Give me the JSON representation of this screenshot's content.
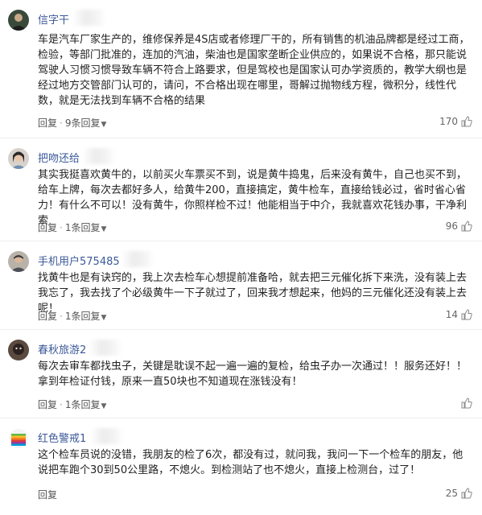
{
  "comments": [
    {
      "username": "信字干",
      "avatar": "dark-portrait",
      "text": "车是汽车厂家生产的，维修保养是4S店或者修理厂干的，所有销售的机油品牌都是经过工商，检验，等部门批准的，连加的汽油，柴油也是国家垄断企业供应的，如果说不合格，那只能说驾驶人习惯习惯导致车辆不符合上路要求，但是驾校也是国家认可办学资质的，教学大纲也是经过地方交管部门认可的，请问，不合格出现在哪里，哥解过抛物线方程，微积分，线性代数，就是无法找到车辆不合格的结果",
      "reply_label": "回复",
      "replies_label": "9条回复",
      "likes": "170"
    },
    {
      "username": "把吻还给",
      "avatar": "girl-portrait",
      "text": "其实我挺喜欢黄牛的，以前买火车票买不到，说是黄牛捣鬼，后来没有黄牛，自己也买不到，给车上牌，每次去都好多人，给黄牛200，直接搞定，黄牛检车，直接给钱必过，省时省心省力！有什么不可以！没有黄牛，你照样检不过！他能相当于中介，我就喜欢花钱办事，干净利索",
      "reply_label": "回复",
      "replies_label": "1条回复",
      "likes": "96"
    },
    {
      "username": "手机用户575485",
      "avatar": "person-portrait",
      "text": "找黄牛也是有诀窍的，我上次去检车心想提前准备哈，就去把三元催化拆下来洗，没有装上去我忘了，我去找了个必级黄牛一下子就过了，回来我才想起来，他妈的三元催化还没有装上去呢！",
      "reply_label": "回复",
      "replies_label": "1条回复",
      "likes": "14"
    },
    {
      "username": "春秋旅游2",
      "avatar": "dark-face",
      "text": "每次去审车都找虫子，关键是耽误不起一遍一遍的复检，给虫子办一次通过！！服务还好！！拿到年检证付钱，原来一直50块也不知道现在涨钱没有！",
      "reply_label": "回复",
      "replies_label": "1条回复",
      "likes": ""
    },
    {
      "username": "红色警戒1",
      "avatar": "apple-logo",
      "text": "这个检车员说的没错，我朋友的检了6次，都没有过，就问我，我问一下一个检车的朋友，他说把车跑个30到50公里路，不熄火。到检测站了也不熄火，直接上检测台，过了！",
      "reply_label": "回复",
      "replies_label": "",
      "likes": "25"
    }
  ],
  "colors": {
    "username": "#3b5998",
    "text": "#222222",
    "meta": "#555555",
    "divider": "#eeeeee"
  }
}
